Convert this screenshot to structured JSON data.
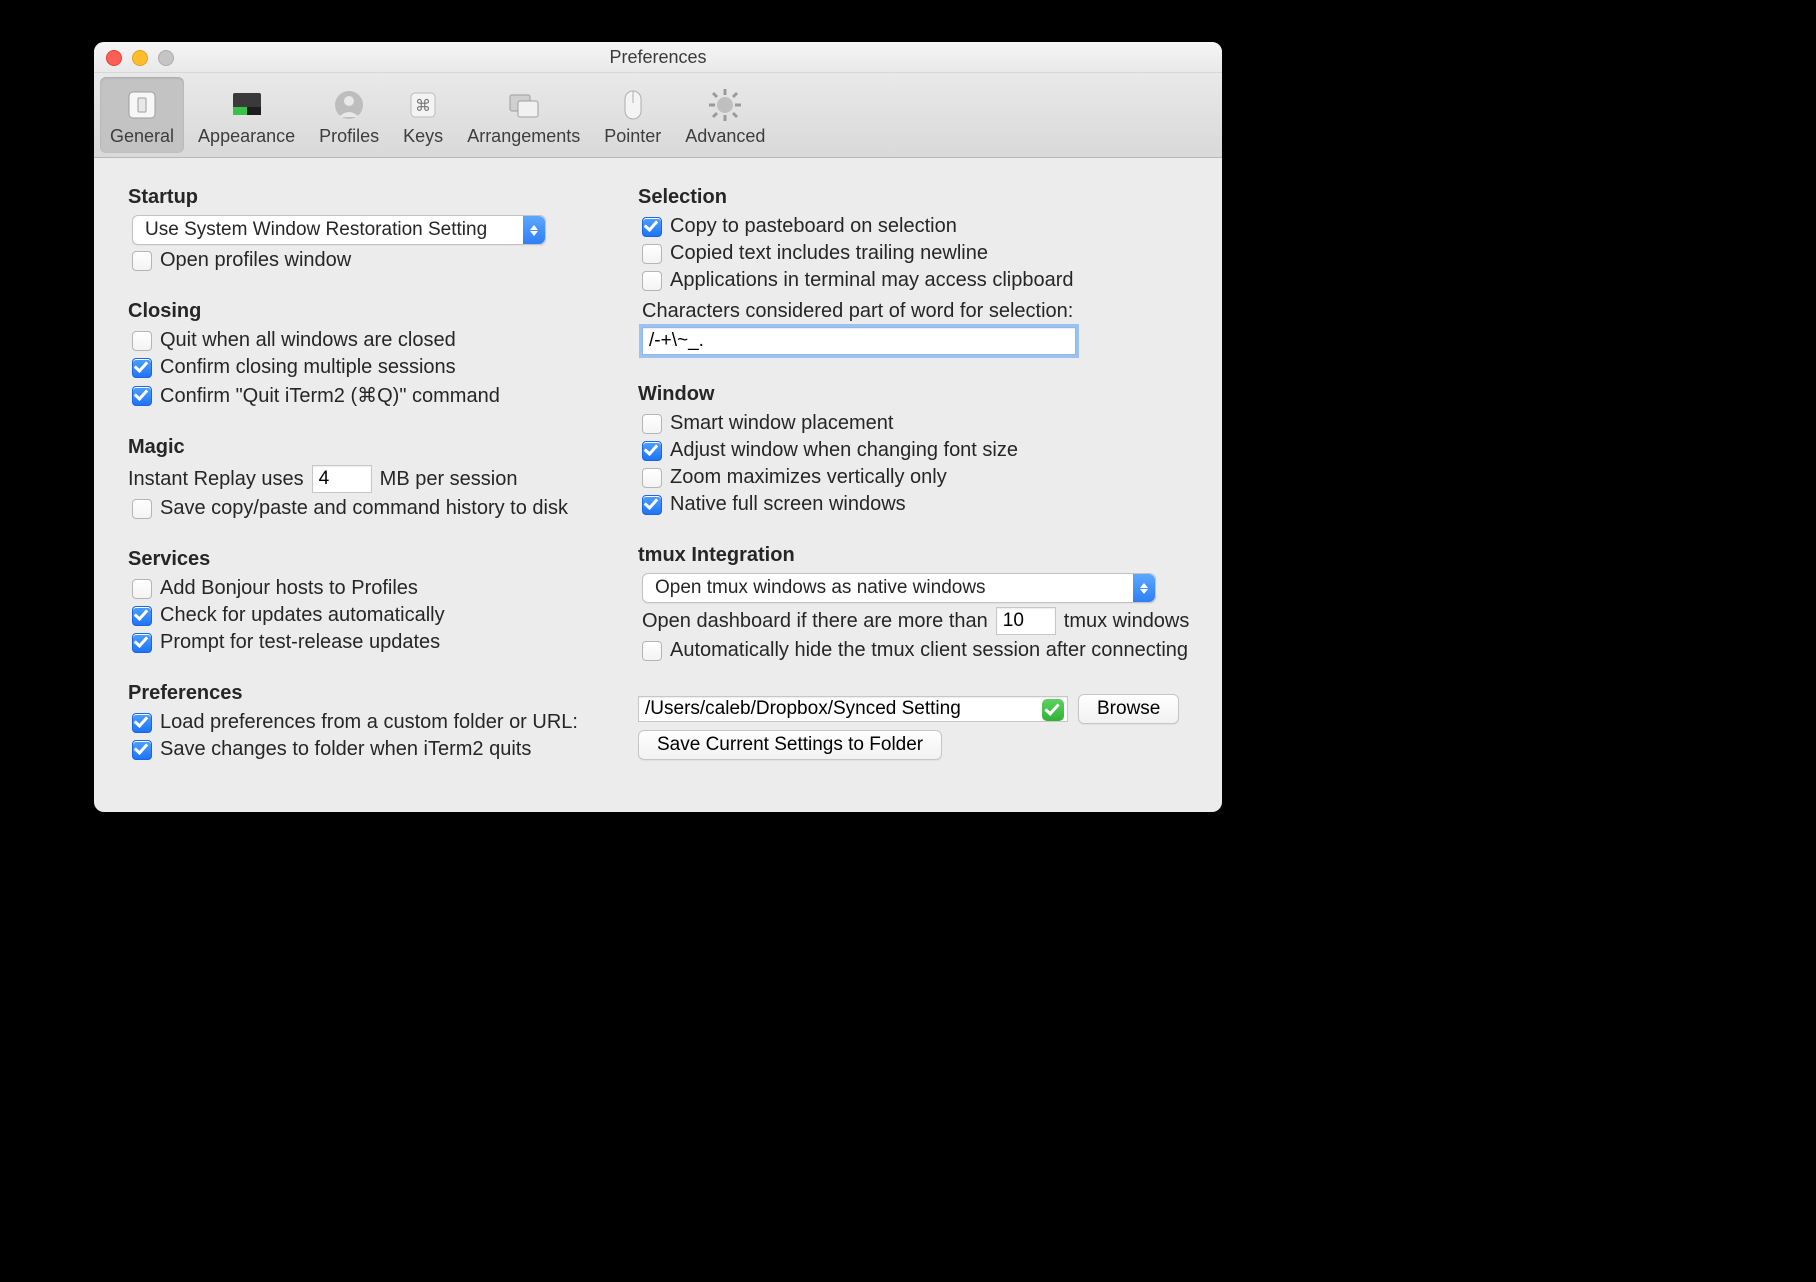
{
  "window": {
    "title": "Preferences"
  },
  "toolbar": {
    "items": [
      {
        "label": "General"
      },
      {
        "label": "Appearance"
      },
      {
        "label": "Profiles"
      },
      {
        "label": "Keys"
      },
      {
        "label": "Arrangements"
      },
      {
        "label": "Pointer"
      },
      {
        "label": "Advanced"
      }
    ]
  },
  "left": {
    "startup": {
      "title": "Startup",
      "popup": "Use System Window Restoration Setting",
      "open_profiles_window": "Open profiles window"
    },
    "closing": {
      "title": "Closing",
      "quit_when_closed": "Quit when all windows are closed",
      "confirm_multi": "Confirm closing multiple sessions",
      "confirm_quit": "Confirm \"Quit iTerm2 (⌘Q)\" command"
    },
    "magic": {
      "title": "Magic",
      "instant_prefix": "Instant Replay uses",
      "instant_value": "4",
      "instant_suffix": "MB per session",
      "save_history": "Save copy/paste and command history to disk"
    },
    "services": {
      "title": "Services",
      "bonjour": "Add Bonjour hosts to Profiles",
      "updates": "Check for updates automatically",
      "testrelease": "Prompt for test-release updates"
    },
    "prefs": {
      "title": "Preferences",
      "load_label": "Load preferences from a custom folder or URL:",
      "save_on_quit": "Save changes to folder when iTerm2 quits"
    }
  },
  "right": {
    "selection": {
      "title": "Selection",
      "copy_pb": "Copy to pasteboard on selection",
      "trailing": "Copied text includes trailing newline",
      "apps_clip": "Applications in terminal may access clipboard",
      "chars_label": "Characters considered part of word for selection:",
      "chars_value": "/-+\\~_."
    },
    "window": {
      "title": "Window",
      "smart": "Smart window placement",
      "adjust": "Adjust window when changing font size",
      "zoom": "Zoom maximizes vertically only",
      "native": "Native full screen windows"
    },
    "tmux": {
      "title": "tmux Integration",
      "popup": "Open tmux windows as native windows",
      "dash_prefix": "Open dashboard if there are more than",
      "dash_value": "10",
      "dash_suffix": "tmux windows",
      "autohide": "Automatically hide the tmux client session after connecting"
    },
    "prefs_row": {
      "path": "/Users/caleb/Dropbox/Synced Setting",
      "browse": "Browse",
      "save_current": "Save Current Settings to Folder"
    }
  }
}
